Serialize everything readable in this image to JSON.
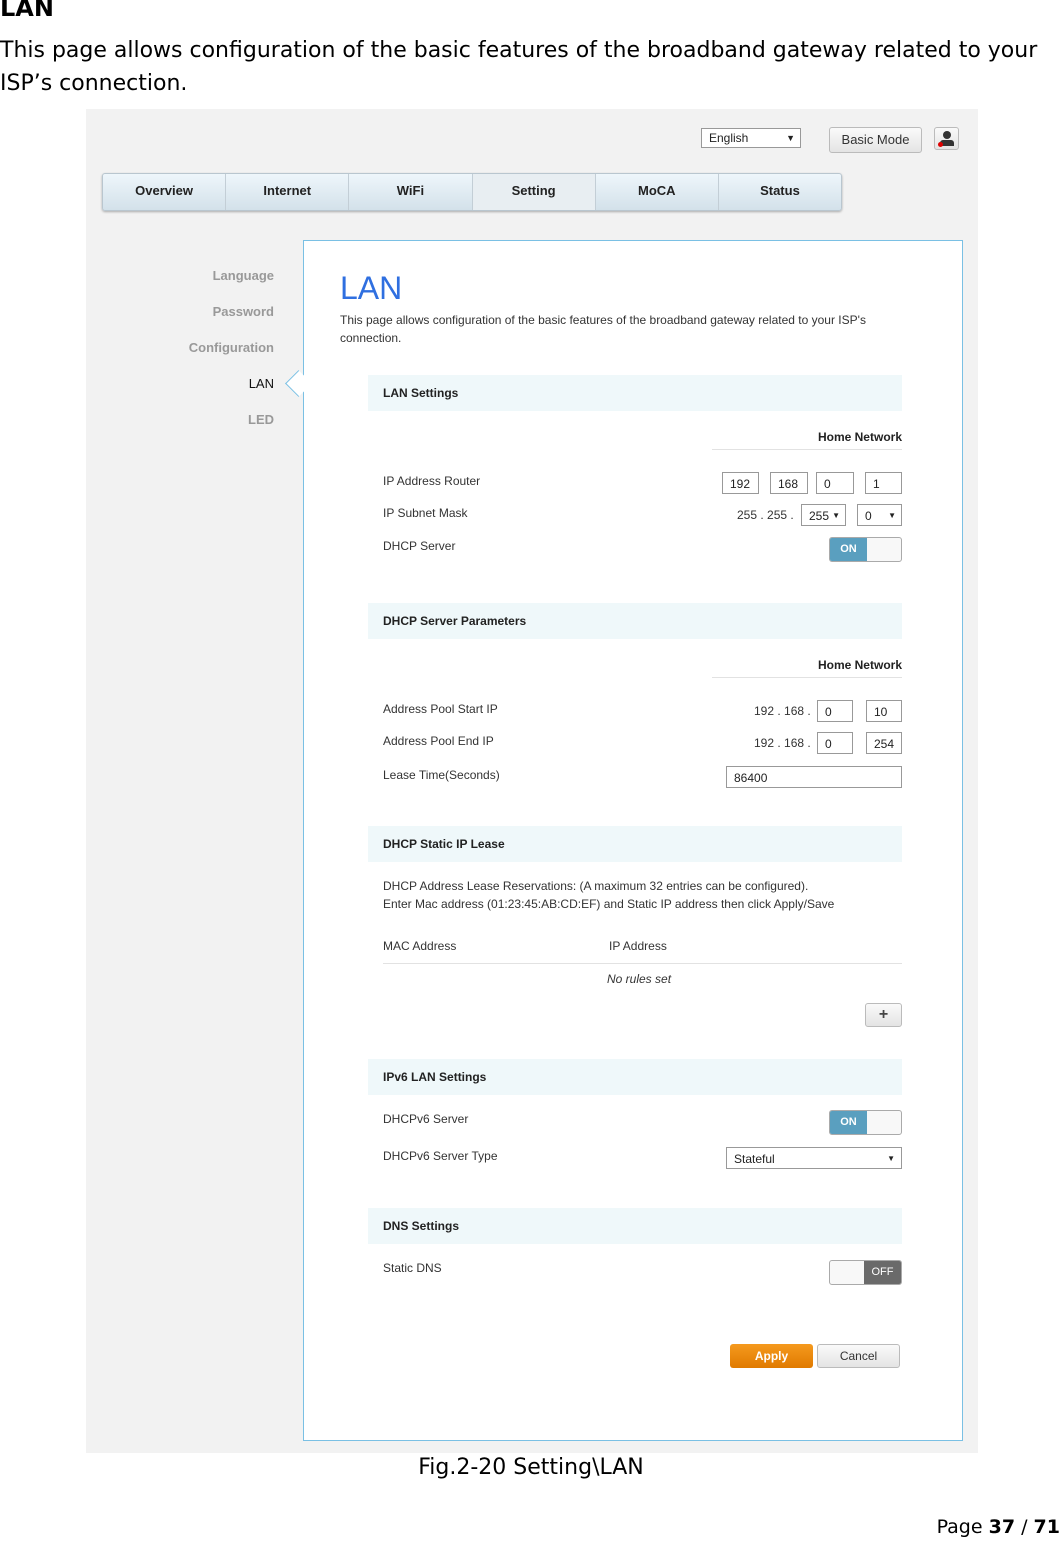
{
  "doc": {
    "heading": "LAN",
    "intro": "This page allows configuration of the basic features of the broadband gateway related to your ISP’s connection.",
    "caption": "Fig.2-20 Setting\\LAN",
    "page_label": "Page ",
    "page_num": "37",
    "page_sep": " / ",
    "page_total": "71"
  },
  "top": {
    "language": "English",
    "basic_mode": "Basic Mode"
  },
  "tabs": [
    "Overview",
    "Internet",
    "WiFi",
    "Setting",
    "MoCA",
    "Status"
  ],
  "sidebar": [
    "Language",
    "Password",
    "Configuration",
    "LAN",
    "LED"
  ],
  "main": {
    "title": "LAN",
    "desc": "This page allows configuration of the basic features of the broadband gateway related to your ISP's connection.",
    "lan": {
      "title": "LAN Settings",
      "col": "Home Network",
      "ip_label": "IP Address Router",
      "ip": [
        "192",
        "168",
        "0",
        "1"
      ],
      "mask_label": "IP Subnet Mask",
      "mask_fixed": "255 . 255 .",
      "mask": [
        "255",
        "0"
      ],
      "dhcp_label": "DHCP Server",
      "dhcp": "ON"
    },
    "dhcp": {
      "title": "DHCP Server Parameters",
      "col": "Home Network",
      "start_label": "Address Pool Start IP",
      "start_prefix": "192 . 168 .",
      "start": [
        "0",
        "10"
      ],
      "end_label": "Address Pool End IP",
      "end_prefix": "192 . 168 .",
      "end": [
        "0",
        "254"
      ],
      "lease_label": "Lease Time(Seconds)",
      "lease": "86400"
    },
    "static": {
      "title": "DHCP Static IP Lease",
      "note1": "DHCP Address Lease Reservations: (A maximum 32 entries can be configured).",
      "note2": "Enter Mac address (01:23:45:AB:CD:EF) and Static IP address then click Apply/Save",
      "col_mac": "MAC Address",
      "col_ip": "IP Address",
      "empty": "No rules set"
    },
    "ipv6": {
      "title": "IPv6 LAN Settings",
      "server_label": "DHCPv6 Server",
      "server": "ON",
      "type_label": "DHCPv6 Server Type",
      "type": "Stateful"
    },
    "dns": {
      "title": "DNS Settings",
      "static_label": "Static DNS",
      "static": "OFF"
    },
    "apply": "Apply",
    "cancel": "Cancel"
  },
  "colors": {
    "accent": "#2f6fe0",
    "apply": "#ee8a0a",
    "toggle_on": "#5a9fbf"
  }
}
